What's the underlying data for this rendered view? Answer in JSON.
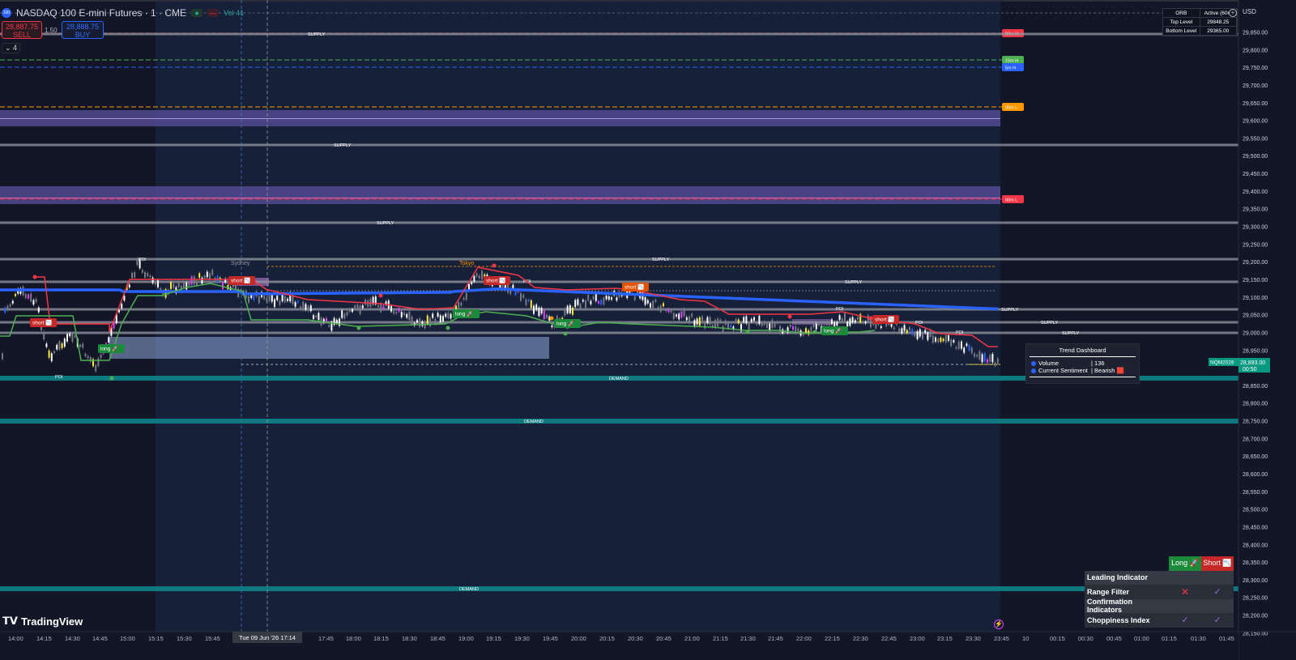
{
  "header": {
    "symbol_badge": "100",
    "title": "NASDAQ 100 E-mini Futures · 1 · CME",
    "volume_label": "Vol",
    "volume_value": "41"
  },
  "trading": {
    "sell_price": "28,887.75",
    "sell_label": "SELL",
    "spread": "1.50",
    "buy_price": "28,888.75",
    "buy_label": "BUY",
    "collapse_label": "4"
  },
  "orb_table": {
    "header_col1": "ORB",
    "header_col2": "Active (60m",
    "rows": [
      {
        "label": "Top Level",
        "value": "29848.25"
      },
      {
        "label": "Bottom Level",
        "value": "29365.00"
      }
    ]
  },
  "currency": "USD",
  "price_axis": {
    "ticks": [
      "29,850.00",
      "29,800.00",
      "29,750.00",
      "29,700.00",
      "29,650.00",
      "29,600.00",
      "29,550.00",
      "29,500.00",
      "29,450.00",
      "29,400.00",
      "29,350.00",
      "29,300.00",
      "29,250.00",
      "29,200.00",
      "29,150.00",
      "29,100.00",
      "29,050.00",
      "29,000.00",
      "28,950.00",
      "28,900.00",
      "28,850.00",
      "28,800.00",
      "28,750.00",
      "28,700.00",
      "28,650.00",
      "28,600.00",
      "28,550.00",
      "28,500.00",
      "28,450.00",
      "28,400.00",
      "28,350.00",
      "28,300.00",
      "28,250.00",
      "28,200.00",
      "28,150.00"
    ],
    "last_symbol": "NQM2026",
    "last_price": "28,893.00",
    "countdown": "00:50"
  },
  "time_axis": {
    "ticks": [
      "14:00",
      "14:15",
      "14:30",
      "14:45",
      "15:00",
      "15:15",
      "15:30",
      "15:45",
      "16:00",
      "17:45",
      "18:00",
      "18:15",
      "18:30",
      "18:45",
      "19:00",
      "19:15",
      "19:30",
      "19:45",
      "20:00",
      "20:15",
      "20:30",
      "20:45",
      "21:00",
      "21:15",
      "21:30",
      "21:45",
      "22:00",
      "22:15",
      "22:30",
      "22:45",
      "23:00",
      "23:15",
      "23:30",
      "23:45",
      "10",
      "00:15",
      "00:30",
      "00:45",
      "01:00",
      "01:15",
      "01:30",
      "01:45"
    ],
    "cursor_label": "Tue 09 Jun '26   17:14"
  },
  "level_labels": {
    "h60": "60m H",
    "h15": "15m H",
    "h5": "5m H",
    "l30": "30m L",
    "l60": "60m L"
  },
  "zone_labels": {
    "supply": "SUPPLY",
    "demand": "DEMAND",
    "poi": "POI"
  },
  "session_labels": {
    "sydney": "Sydney",
    "tokyo": "Tokyo"
  },
  "signals": {
    "long": "long 🚀",
    "short": "short 📉"
  },
  "trend_dashboard": {
    "title": "Trend Dashboard",
    "rows": [
      {
        "label": "Volume",
        "value": "| 136"
      },
      {
        "label": "Current Sentiment",
        "value": "| Bearish 🟥"
      }
    ]
  },
  "signal_table": {
    "long_header": "Long 🚀",
    "short_header": "Short 📉",
    "rows": [
      {
        "label": "Leading Indicator",
        "long": "",
        "short": "",
        "section": true
      },
      {
        "label": "Range Filter",
        "long": "✕",
        "short": "✓",
        "section": false
      },
      {
        "label": "Confirmation Indicators",
        "long": "",
        "short": "",
        "section": true
      },
      {
        "label": "Choppiness Index",
        "long": "✓",
        "short": "✓",
        "section": false
      }
    ]
  },
  "brand": "TradingView",
  "colors": {
    "background": "#121626",
    "session_bg": "#172039",
    "up_candle": "#ffffff",
    "down_candle": "#787b86",
    "ema_blue": "#2962ff",
    "trail_red": "#f23645",
    "trail_green": "#4caf50",
    "demand_teal": "#0e7a80",
    "supply_gray": "#9598a1",
    "zone_purple": "#5b4f9e"
  }
}
